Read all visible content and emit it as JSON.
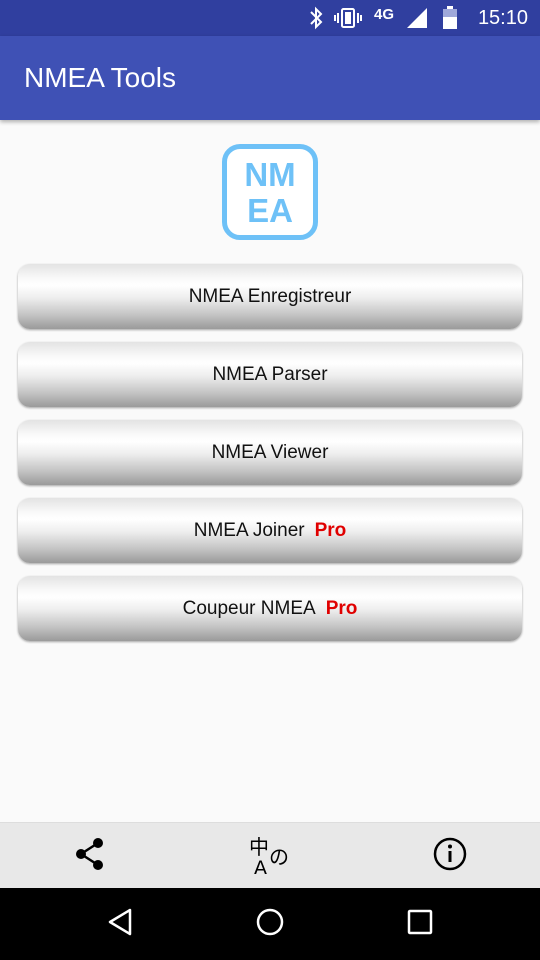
{
  "status_bar": {
    "time": "15:10",
    "network": "4G",
    "icons": [
      "bluetooth-icon",
      "vibrate-icon",
      "signal-icon",
      "battery-icon"
    ]
  },
  "app_bar": {
    "title": "NMEA Tools"
  },
  "logo": {
    "line1": "NM",
    "line2": "EA"
  },
  "menu": {
    "items": [
      {
        "label": "NMEA Enregistreur",
        "badge": ""
      },
      {
        "label": "NMEA Parser",
        "badge": ""
      },
      {
        "label": "NMEA Viewer",
        "badge": ""
      },
      {
        "label": "NMEA Joiner",
        "badge": "Pro"
      },
      {
        "label": "Coupeur NMEA",
        "badge": "Pro"
      }
    ]
  },
  "bottom_bar": {
    "icons": [
      "share-icon",
      "translate-icon",
      "info-icon"
    ]
  },
  "nav_bar": {
    "icons": [
      "back-icon",
      "home-icon",
      "recents-icon"
    ]
  },
  "colors": {
    "status_bar": "#303f9f",
    "app_bar": "#3f51b5",
    "logo": "#6ec1f7",
    "pro_badge": "#e00000"
  }
}
